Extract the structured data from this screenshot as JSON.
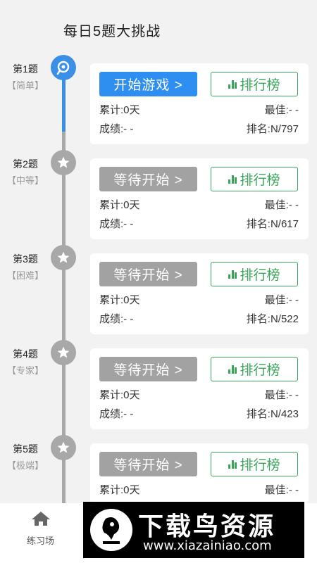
{
  "header": {
    "title": "每日5题大挑战"
  },
  "levels": [
    {
      "name": "第1题",
      "difficulty": "【简单】",
      "button": "开始游戏 >",
      "rank_button": "排行榜",
      "total": "累计:0天",
      "best": "最佳:- -",
      "score": "成绩:- -",
      "ranking": "排名:N/797"
    },
    {
      "name": "第2题",
      "difficulty": "【中等】",
      "button": "等待开始 >",
      "rank_button": "排行榜",
      "total": "累计:0天",
      "best": "最佳:- -",
      "score": "成绩:- -",
      "ranking": "排名:N/617"
    },
    {
      "name": "第3题",
      "difficulty": "【困难】",
      "button": "等待开始 >",
      "rank_button": "排行榜",
      "total": "累计:0天",
      "best": "最佳:- -",
      "score": "成绩:- -",
      "ranking": "排名:N/522"
    },
    {
      "name": "第4题",
      "difficulty": "【专家】",
      "button": "等待开始 >",
      "rank_button": "排行榜",
      "total": "累计:0天",
      "best": "最佳:- -",
      "score": "成绩:- -",
      "ranking": "排名:N/423"
    },
    {
      "name": "第5题",
      "difficulty": "【极端】",
      "button": "等待开始 >",
      "rank_button": "排行榜",
      "total": "累计:0天",
      "best": "最佳:- -"
    }
  ],
  "tabbar": {
    "home_label": "练习场"
  },
  "watermark": {
    "title": "下载鸟资源",
    "url": "www.xiazainiao.com"
  },
  "colors": {
    "accent": "#2f8ff0",
    "rank_green": "#3aa55a",
    "waiting_gray": "#a2a2a2"
  }
}
